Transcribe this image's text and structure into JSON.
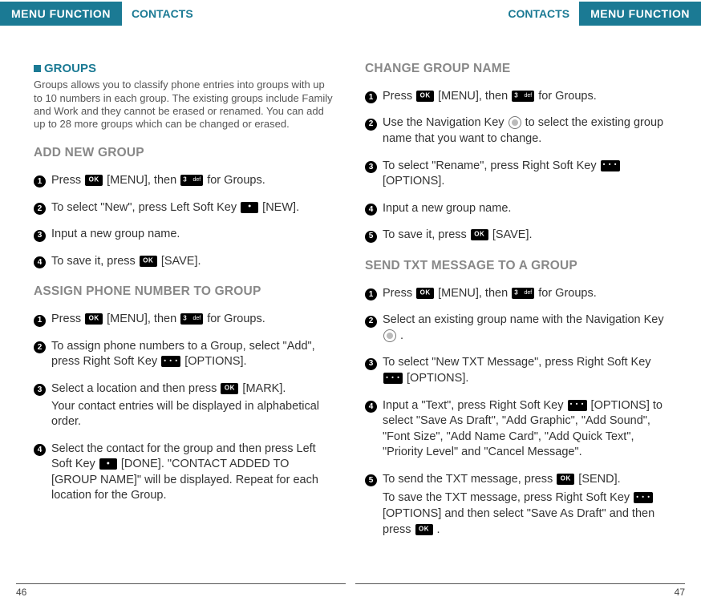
{
  "header": {
    "menu_label": "MENU FUNCTION",
    "section_label": "CONTACTS"
  },
  "left_page": {
    "section_title": "GROUPS",
    "intro": "Groups allows you to classify phone entries into groups with up to 10 numbers in each group. The existing groups include Family and Work and they cannot be erased or renamed. You can add up to 28 more groups which can be changed or erased.",
    "sub1": "ADD NEW GROUP",
    "sub1_steps": {
      "s1a": "Press ",
      "s1b": " [MENU], then ",
      "s1c": " for Groups.",
      "s2a": "To select \"New\", press Left Soft Key ",
      "s2b": " [NEW].",
      "s3": "Input a new group name.",
      "s4a": "To save it, press ",
      "s4b": " [SAVE]."
    },
    "sub2": "ASSIGN PHONE NUMBER TO GROUP",
    "sub2_steps": {
      "s1a": "Press ",
      "s1b": " [MENU], then ",
      "s1c": " for Groups.",
      "s2a": "To assign phone numbers to a Group, select \"Add\", press Right Soft Key ",
      "s2b": " [OPTIONS].",
      "s3a": "Select a location and then press ",
      "s3b": " [MARK].",
      "s3c": "Your contact entries will be displayed in alphabetical order.",
      "s4a": "Select the contact for the group and then press Left Soft Key ",
      "s4b": " [DONE]. \"CONTACT ADDED TO [GROUP NAME]\" will be displayed. Repeat for each location for the Group."
    },
    "page_num": "46"
  },
  "right_page": {
    "sub1": "CHANGE GROUP NAME",
    "sub1_steps": {
      "s1a": "Press ",
      "s1b": " [MENU], then ",
      "s1c": " for Groups.",
      "s2a": "Use the Navigation Key ",
      "s2b": " to select the existing group name that you want to change.",
      "s3a": "To select \"Rename\", press Right Soft Key ",
      "s3b": " [OPTIONS].",
      "s4": "Input a new group name.",
      "s5a": "To save it, press ",
      "s5b": " [SAVE]."
    },
    "sub2": "SEND TXT MESSAGE TO A GROUP",
    "sub2_steps": {
      "s1a": "Press ",
      "s1b": " [MENU], then ",
      "s1c": " for Groups.",
      "s2a": "Select an existing group name with the Navigation Key ",
      "s2b": " .",
      "s3a": "To select \"New TXT Message\", press Right Soft Key ",
      "s3b": " [OPTIONS].",
      "s4a": "Input a \"Text\", press Right Soft Key ",
      "s4b": " [OPTIONS] to select \"Save As Draft\", \"Add Graphic\", \"Add Sound\", \"Font Size\", \"Add Name Card\", \"Add Quick Text\", \"Priority Level\" and \"Cancel Message\".",
      "s5a": "To send the TXT message, press ",
      "s5b": " [SEND].",
      "s5c1": "To save the TXT message, press Right Soft Key ",
      "s5c2": " [OPTIONS] and then select \"Save As Draft\" and then press ",
      "s5c3": " ."
    },
    "page_num": "47"
  },
  "nums": {
    "1": "1",
    "2": "2",
    "3": "3",
    "4": "4",
    "5": "5"
  }
}
